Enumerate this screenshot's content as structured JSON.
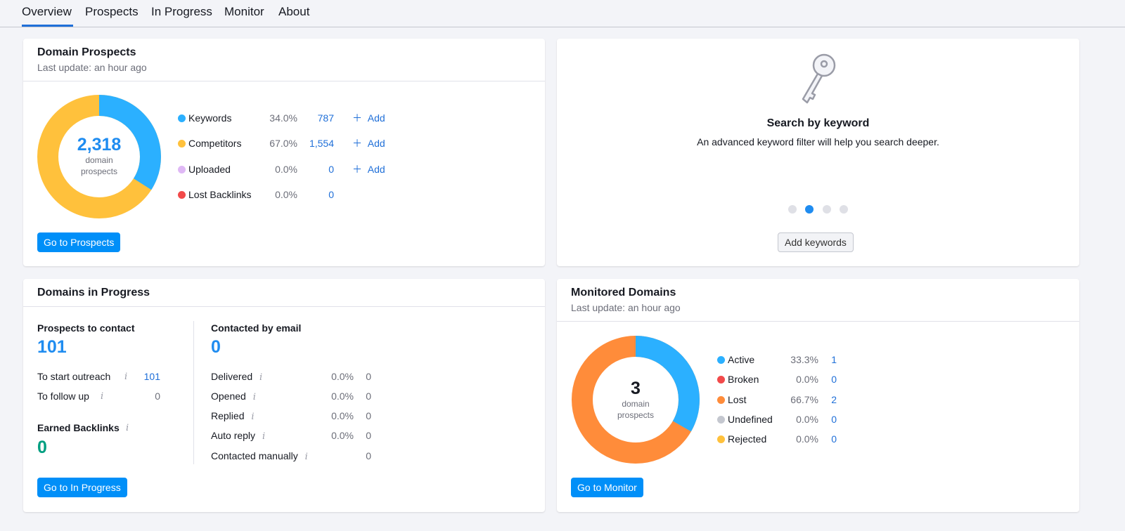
{
  "tabs": [
    {
      "label": "Overview",
      "active": true
    },
    {
      "label": "Prospects",
      "active": false
    },
    {
      "label": "In Progress",
      "active": false
    },
    {
      "label": "Monitor",
      "active": false
    },
    {
      "label": "About",
      "active": false
    }
  ],
  "domain_prospects": {
    "title": "Domain Prospects",
    "subtitle": "Last update: an hour ago",
    "total": "2,318",
    "total_label_1": "domain",
    "total_label_2": "prospects",
    "rows": [
      {
        "label": "Keywords",
        "pct": "34.0%",
        "value": "787",
        "add": "Add",
        "color": "#2bb0ff"
      },
      {
        "label": "Competitors",
        "pct": "67.0%",
        "value": "1,554",
        "add": "Add",
        "color": "#ffc13c"
      },
      {
        "label": "Uploaded",
        "pct": "0.0%",
        "value": "0",
        "add": "Add",
        "color": "#dfb8f5"
      },
      {
        "label": "Lost Backlinks",
        "pct": "0.0%",
        "value": "0",
        "color": "#f24a4a"
      }
    ],
    "chart_fractions": {
      "Keywords": 0.34,
      "Competitors": 0.66
    },
    "button": "Go to Prospects"
  },
  "search_card": {
    "title": "Search by keyword",
    "description": "An advanced keyword filter will help you search deeper.",
    "pager_active": 2,
    "pager_count": 4,
    "button": "Add keywords"
  },
  "in_progress": {
    "title": "Domains in Progress",
    "prospects_label": "Prospects to contact",
    "prospects_value": "101",
    "to_start_label": "To start outreach",
    "to_start_value": "101",
    "to_follow_label": "To follow up",
    "to_follow_value": "0",
    "earned_label": "Earned Backlinks",
    "earned_value": "0",
    "contacted_label": "Contacted by email",
    "contacted_value": "0",
    "email_rows": [
      {
        "label": "Delivered",
        "pct": "0.0%",
        "value": "0"
      },
      {
        "label": "Opened",
        "pct": "0.0%",
        "value": "0"
      },
      {
        "label": "Replied",
        "pct": "0.0%",
        "value": "0"
      },
      {
        "label": "Auto reply",
        "pct": "0.0%",
        "value": "0"
      },
      {
        "label": "Contacted manually",
        "pct": "",
        "value": "0"
      }
    ],
    "info_glyph": "i",
    "button": "Go to In Progress"
  },
  "monitored": {
    "title": "Monitored Domains",
    "subtitle": "Last update: an hour ago",
    "total": "3",
    "total_label_1": "domain",
    "total_label_2": "prospects",
    "rows": [
      {
        "label": "Active",
        "pct": "33.3%",
        "value": "1",
        "color": "#2bb0ff"
      },
      {
        "label": "Broken",
        "pct": "0.0%",
        "value": "0",
        "color": "#f24a4a"
      },
      {
        "label": "Lost",
        "pct": "66.7%",
        "value": "2",
        "color": "#ff8c3a"
      },
      {
        "label": "Undefined",
        "pct": "0.0%",
        "value": "0",
        "color": "#c4c7cf"
      },
      {
        "label": "Rejected",
        "pct": "0.0%",
        "value": "0",
        "color": "#ffc13c"
      }
    ],
    "chart_fractions": {
      "Active": 0.333,
      "Lost": 0.667
    },
    "button": "Go to Monitor"
  },
  "colors": {
    "accent": "#008ff8",
    "link": "#1f6fd8",
    "green": "#009f81",
    "keywords": "#2bb0ff",
    "competitors": "#ffc13c",
    "lost": "#ff8c3a"
  }
}
